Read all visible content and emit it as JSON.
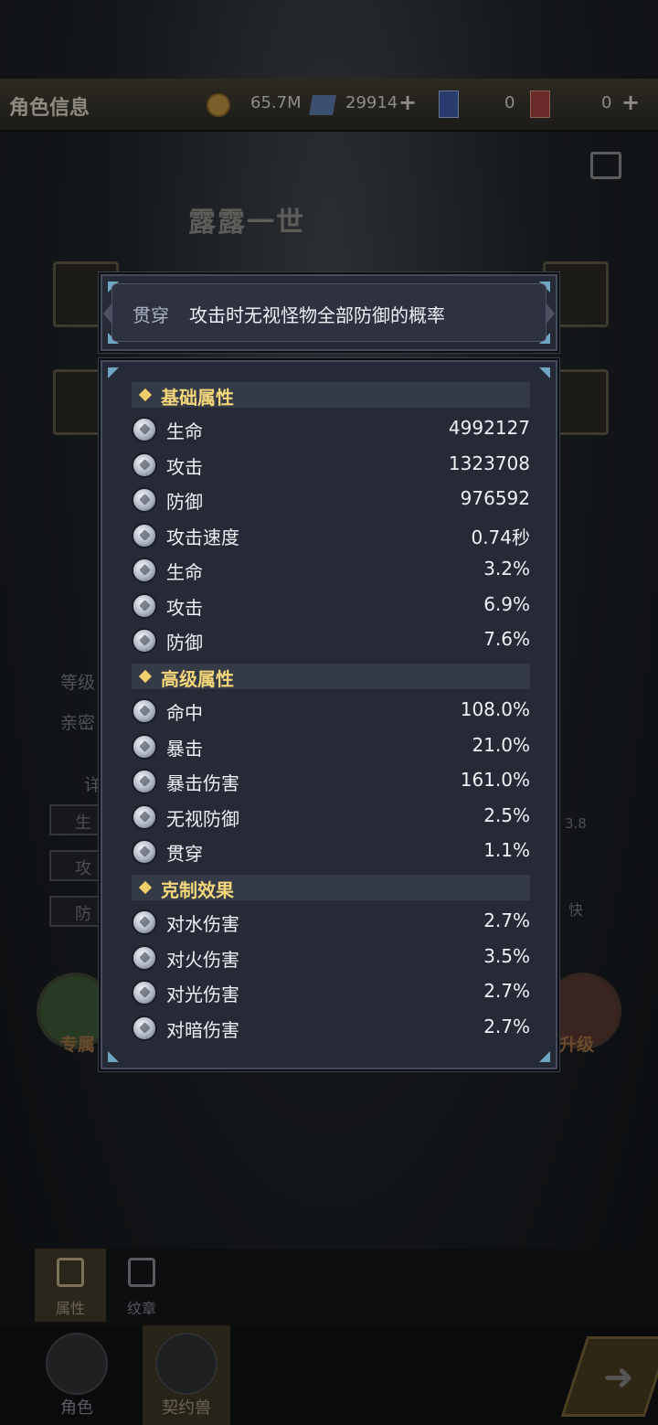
{
  "header": {
    "title": "角色信息",
    "gold": "65.7M",
    "gems": "29914",
    "card_blue": "0",
    "card_red": "0"
  },
  "hero": {
    "name": "露露一世"
  },
  "background": {
    "level_label": "等级",
    "intimacy_label": "亲密",
    "detail_label": "详",
    "stat_hp": "生",
    "stat_atk": "攻",
    "stat_def": "防",
    "side_value": "3.8",
    "side_speed": "快",
    "exclusive_label": "专属",
    "upgrade_label": "升级"
  },
  "tooltip": {
    "label": "贯穿",
    "description": "攻击时无视怪物全部防御的概率"
  },
  "sections": [
    {
      "title": "基础属性",
      "rows": [
        {
          "icon": "heart-icon",
          "label": "生命",
          "value": "4992127"
        },
        {
          "icon": "sword-icon",
          "label": "攻击",
          "value": "1323708"
        },
        {
          "icon": "shield-icon",
          "label": "防御",
          "value": "976592"
        },
        {
          "icon": "wing-icon",
          "label": "攻击速度",
          "value": "0.74秒"
        },
        {
          "icon": "heart-icon",
          "label": "生命",
          "value": "3.2%"
        },
        {
          "icon": "sword-icon",
          "label": "攻击",
          "value": "6.9%"
        },
        {
          "icon": "shield-icon",
          "label": "防御",
          "value": "7.6%"
        }
      ]
    },
    {
      "title": "高级属性",
      "rows": [
        {
          "icon": "target-icon",
          "label": "命中",
          "value": "108.0%"
        },
        {
          "icon": "crit-icon",
          "label": "暴击",
          "value": "21.0%"
        },
        {
          "icon": "burst-icon",
          "label": "暴击伤害",
          "value": "161.0%"
        },
        {
          "icon": "ignore-defense-icon",
          "label": "无视防御",
          "value": "2.5%"
        },
        {
          "icon": "pierce-icon",
          "label": "贯穿",
          "value": "1.1%"
        }
      ]
    },
    {
      "title": "克制效果",
      "rows": [
        {
          "icon": "water-icon",
          "label": "对水伤害",
          "value": "2.7%"
        },
        {
          "icon": "fire-icon",
          "label": "对火伤害",
          "value": "3.5%"
        },
        {
          "icon": "light-icon",
          "label": "对光伤害",
          "value": "2.7%"
        },
        {
          "icon": "dark-icon",
          "label": "对暗伤害",
          "value": "2.7%"
        }
      ]
    }
  ],
  "subtabs": [
    {
      "label": "属性"
    },
    {
      "label": "纹章"
    }
  ],
  "bottom_nav": [
    {
      "label": "角色"
    },
    {
      "label": "契约兽"
    }
  ]
}
